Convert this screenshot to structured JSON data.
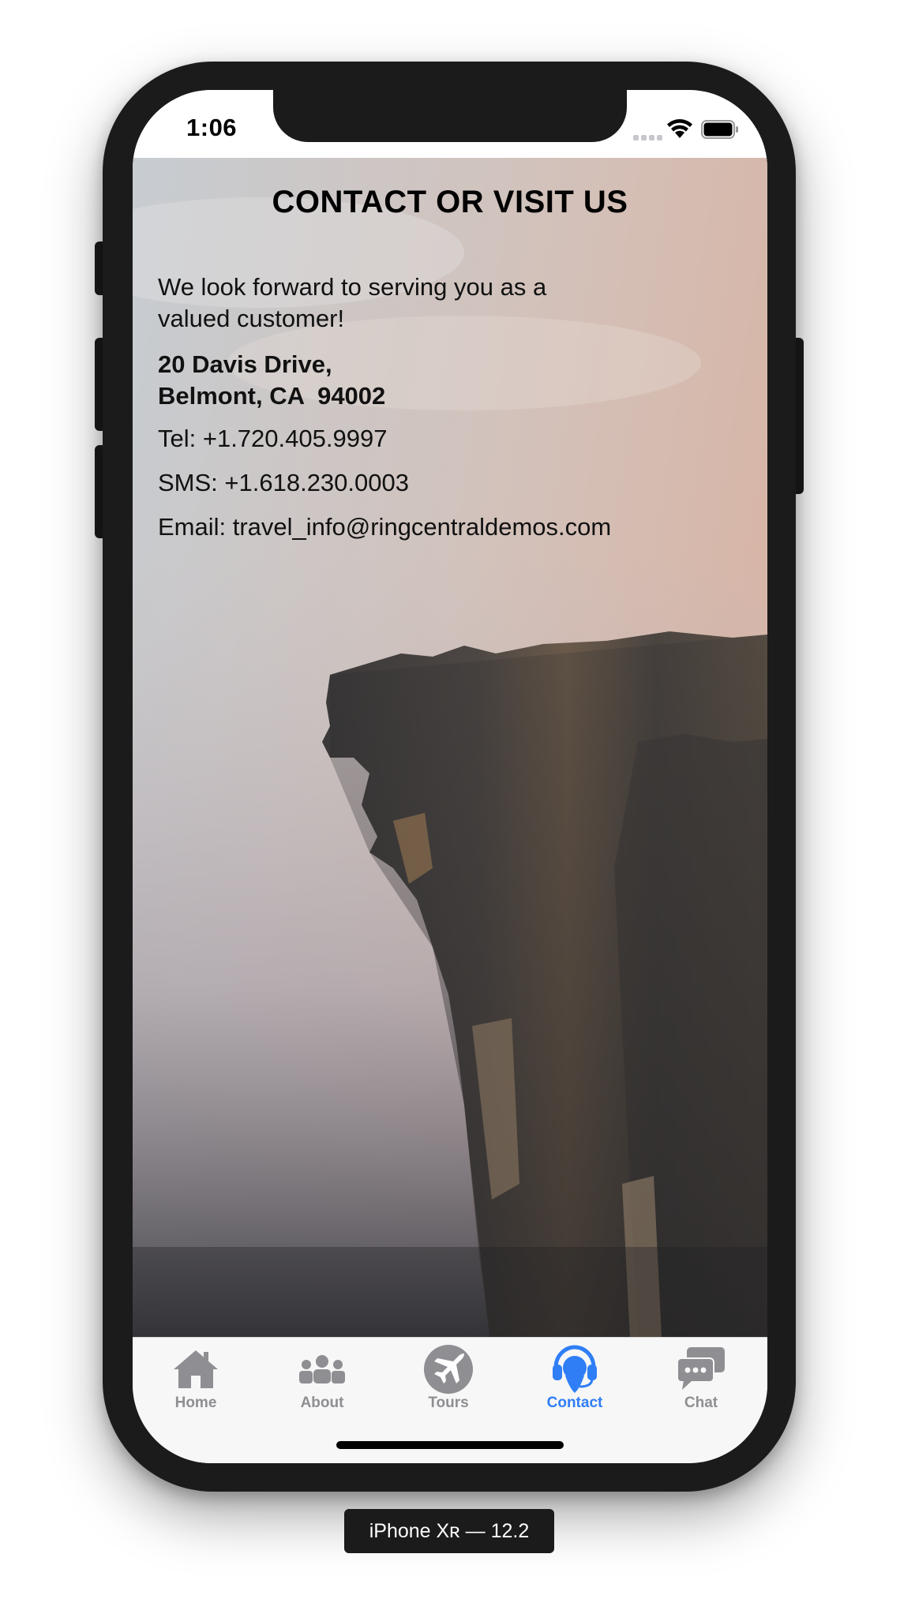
{
  "status_bar": {
    "time": "1:06"
  },
  "page": {
    "title": "CONTACT OR VISIT US",
    "intro": "We look forward to serving you as a valued customer!",
    "address_line1": "20 Davis Drive,",
    "address_line2": "Belmont, CA  94002",
    "tel": "Tel: +1.720.405.9997",
    "sms": "SMS: +1.618.230.0003",
    "email": "Email: travel_info@ringcentraldemos.com"
  },
  "tabs": [
    {
      "label": "Home",
      "icon": "home-icon",
      "active": false
    },
    {
      "label": "About",
      "icon": "people-icon",
      "active": false
    },
    {
      "label": "Tours",
      "icon": "airplane-icon",
      "active": false
    },
    {
      "label": "Contact",
      "icon": "headset-icon",
      "active": true
    },
    {
      "label": "Chat",
      "icon": "chat-bubbles-icon",
      "active": false
    }
  ],
  "simulator": {
    "device_label": "iPhone Xʀ — 12.2"
  },
  "colors": {
    "accent": "#2f7ef6",
    "inactive": "#8e8e93",
    "frame": "#1b1b1c"
  }
}
